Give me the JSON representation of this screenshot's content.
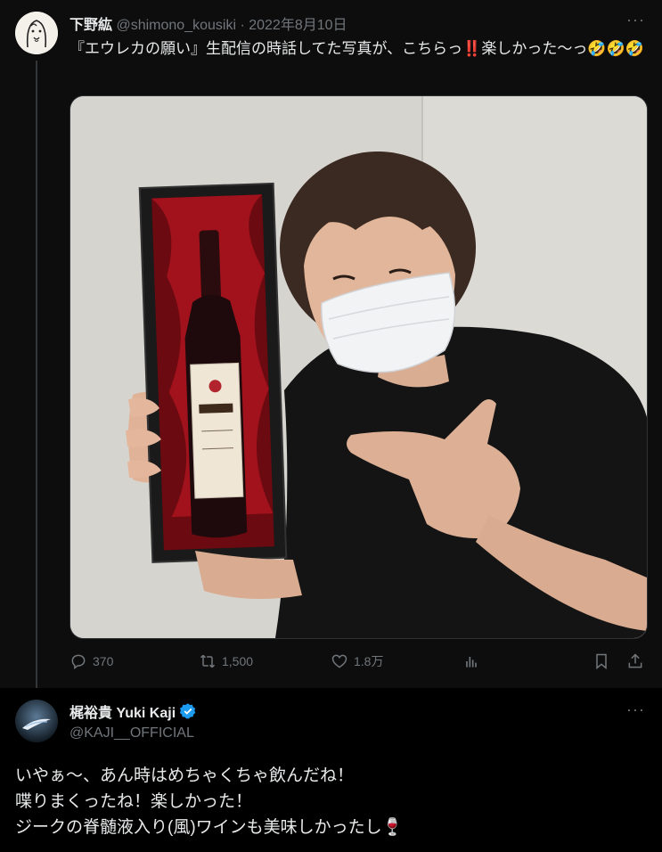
{
  "tweet1": {
    "display_name": "下野紘",
    "handle": "@shimono_kousiki",
    "separator": " · ",
    "date": "2022年8月10日",
    "more": "···",
    "text": "『エウレカの願い』生配信の時話してた写真が、こちらっ‼️楽しかった〜っ🤣🤣🤣",
    "actions": {
      "replies": "370",
      "retweets": "1,500",
      "likes": "1.8万"
    }
  },
  "tweet2": {
    "display_name": "梶裕貴 Yuki Kaji",
    "handle": "@KAJI__OFFICIAL",
    "more": "···",
    "lines": [
      "いやぁ〜、あん時はめちゃくちゃ飲んだね！",
      "喋りまくったね！楽しかった！",
      "ジークの脊髄液入り(風)ワインも美味しかったし🍷"
    ]
  },
  "colors": {
    "background": "#000000",
    "text": "#e7e9ea",
    "muted": "#71767b",
    "verified": "#1d9bf0"
  }
}
